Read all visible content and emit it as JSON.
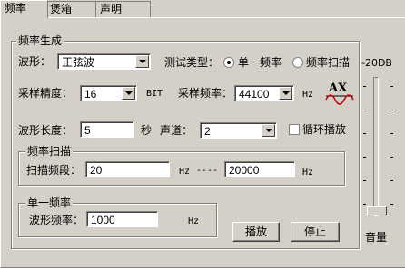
{
  "tabs": [
    {
      "label": "频率"
    },
    {
      "label": "煲箱"
    },
    {
      "label": "声明"
    }
  ],
  "generation_group": {
    "title": "频率生成"
  },
  "waveform": {
    "label": "波形：",
    "value": "正弦波"
  },
  "test_type": {
    "label": "测试类型：",
    "option_single": "单一频率",
    "option_sweep": "频率扫描",
    "selected": "单一频率"
  },
  "volume_top": "-20DB",
  "sample_precision": {
    "label": "采样精度：",
    "value": "16",
    "unit": "BIT"
  },
  "sample_rate": {
    "label": "采样频率：",
    "value": "44100",
    "unit": "Hz"
  },
  "ax_logo": "AX",
  "wave_length": {
    "label": "波形长度：",
    "value": "5",
    "unit": "秒"
  },
  "channel": {
    "label": "声道：",
    "value": "2"
  },
  "loop": {
    "label": "循环播放",
    "checked": false
  },
  "sweep_group": {
    "title": "频率扫描",
    "range_label": "扫描频段：",
    "from": "20",
    "from_unit": "Hz",
    "dash": "----",
    "to": "20000",
    "to_unit": "Hz"
  },
  "single_group": {
    "title": "单一频率",
    "freq_label": "波形频率：",
    "value": "1000",
    "unit": "Hz"
  },
  "buttons": {
    "play": "播放",
    "stop": "停止"
  },
  "volume_label": "音量"
}
